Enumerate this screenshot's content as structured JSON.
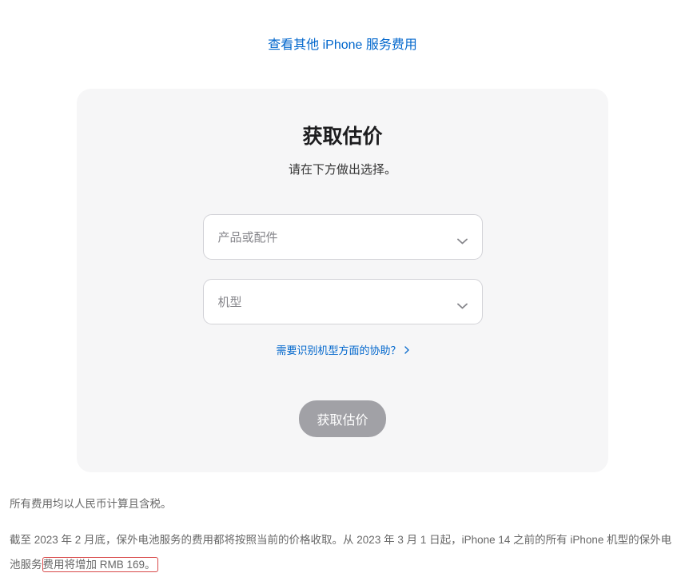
{
  "header": {
    "link_text": "查看其他 iPhone 服务费用"
  },
  "card": {
    "title": "获取估价",
    "subtitle": "请在下方做出选择。",
    "select1_placeholder": "产品或配件",
    "select2_placeholder": "机型",
    "help_link": "需要识别机型方面的协助？",
    "submit_label": "获取估价"
  },
  "footer": {
    "line1": "所有费用均以人民币计算且含税。",
    "line2_pre": "截至 2023 年 2 月底，保外电池服务的费用都将按照当前的价格收取。从 2023 年 3 月 1 日起，iPhone 14 之前的所有 iPhone 机型的保外电池服务",
    "line2_highlight": "费用将增加 RMB 169。"
  }
}
